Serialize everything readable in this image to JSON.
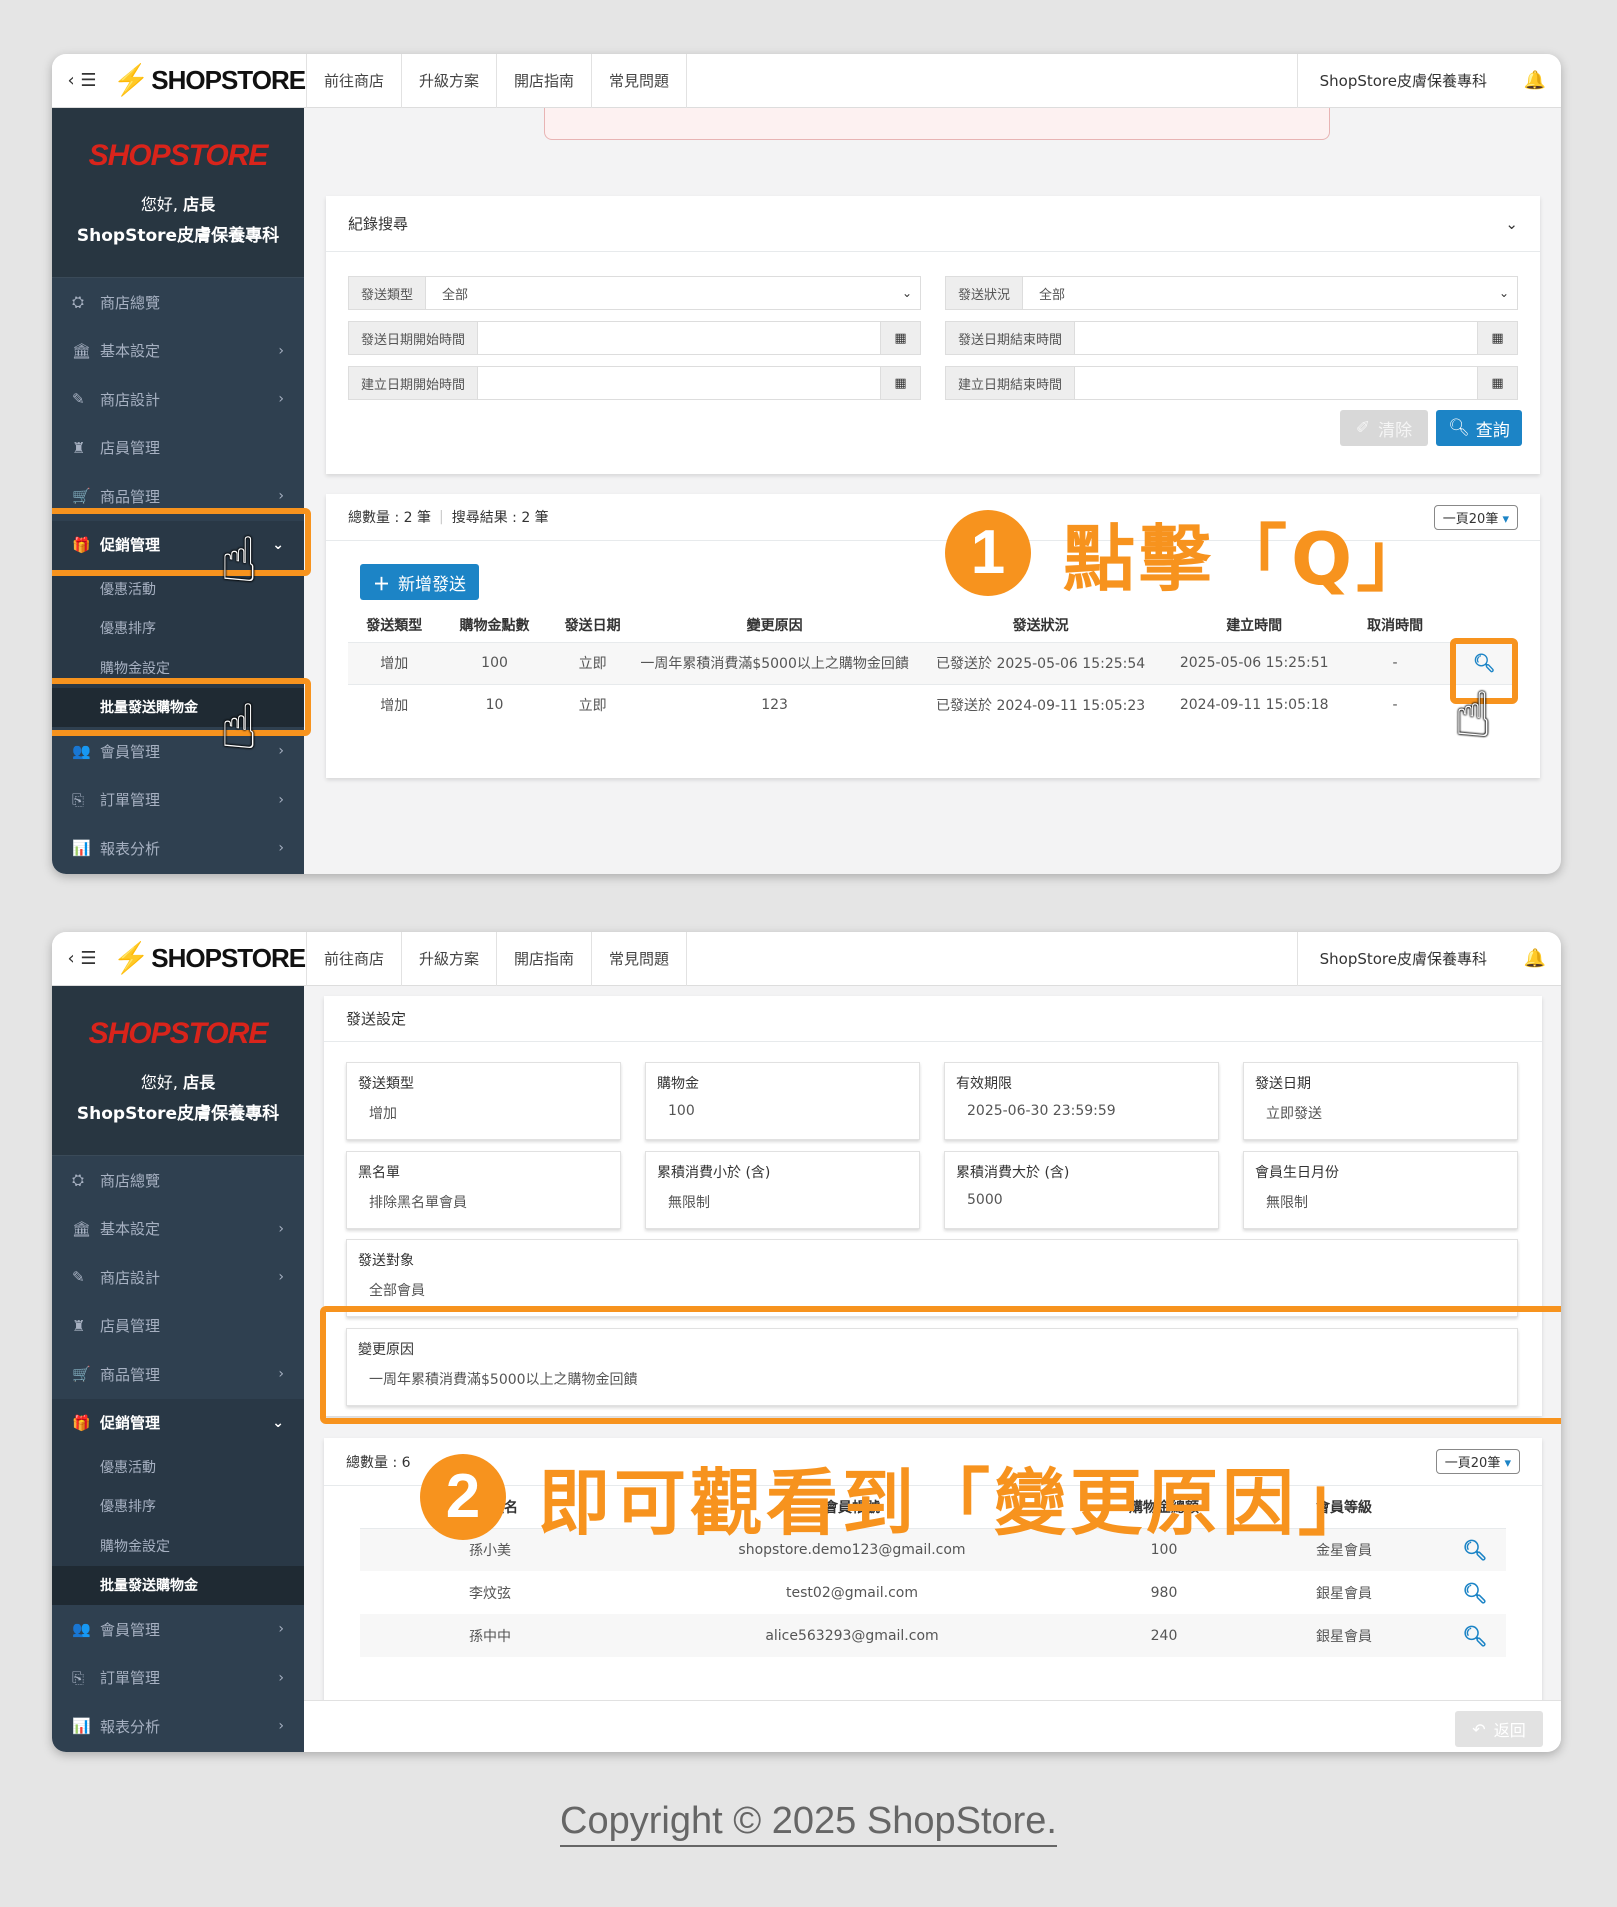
{
  "topbar": {
    "toggle": "‹ ☰",
    "logo": "SHOPSTORE",
    "nav": [
      "前往商店",
      "升級方案",
      "開店指南",
      "常見問題"
    ],
    "store_name": "ShopStore皮膚保養專科",
    "bell": "🔔"
  },
  "sidebar": {
    "logo": "SHOPSTORE",
    "hello": "您好,",
    "role": "店長",
    "store": "ShopStore皮膚保養專科",
    "items": [
      {
        "label": "商店總覽",
        "icon": "⛭"
      },
      {
        "label": "基本設定",
        "icon": "🏛"
      },
      {
        "label": "商店設計",
        "icon": "✎"
      },
      {
        "label": "店員管理",
        "icon": "♜"
      },
      {
        "label": "商品管理",
        "icon": "🛒"
      },
      {
        "label": "促銷管理",
        "icon": "🎁"
      }
    ],
    "sub_items": [
      "優惠活動",
      "優惠排序",
      "購物金設定",
      "批量發送購物金"
    ],
    "items_after": [
      {
        "label": "會員管理",
        "icon": "👥"
      },
      {
        "label": "訂單管理",
        "icon": "⎘"
      },
      {
        "label": "報表分析",
        "icon": "📊"
      }
    ],
    "chevron_right": "›",
    "chevron_down": "⌄"
  },
  "search": {
    "title": "紀錄搜尋",
    "collapse": "⌄",
    "send_type_label": "發送類型",
    "send_type_value": "全部",
    "send_status_label": "發送狀況",
    "send_status_value": "全部",
    "send_date_start": "發送日期開始時間",
    "send_date_end": "發送日期結束時間",
    "create_date_start": "建立日期開始時間",
    "create_date_end": "建立日期結束時間",
    "calendar_icon": "▦",
    "select_caret": "⌄",
    "clear_label": "清除",
    "query_label": "查詢"
  },
  "results": {
    "total": "總數量 : 2 筆",
    "search_result": "搜尋結果 : 2 筆",
    "per_page": "一頁20筆",
    "add_label": "新增發送",
    "headers": [
      "發送類型",
      "購物金點數",
      "發送日期",
      "變更原因",
      "發送狀況",
      "建立時間",
      "取消時間"
    ],
    "rows": [
      [
        "增加",
        "100",
        "立即",
        "一周年累積消費滿$5000以上之購物金回饋",
        "已發送於 2025-05-06 15:25:54",
        "2025-05-06 15:25:51",
        "-"
      ],
      [
        "增加",
        "10",
        "立即",
        "123",
        "已發送於 2024-09-11 15:05:23",
        "2024-09-11 15:05:18",
        "-"
      ]
    ]
  },
  "step1": {
    "number": "1",
    "text": "點擊「Q」"
  },
  "detail": {
    "title": "發送設定",
    "fields": [
      {
        "label": "發送類型",
        "value": "增加"
      },
      {
        "label": "購物金",
        "value": "100"
      },
      {
        "label": "有效期限",
        "value": "2025-06-30 23:59:59"
      },
      {
        "label": "發送日期",
        "value": "立即發送"
      },
      {
        "label": "黑名單",
        "value": "排除黑名單會員"
      },
      {
        "label": "累積消費小於 (含)",
        "value": "無限制"
      },
      {
        "label": "累積消費大於 (含)",
        "value": "5000"
      },
      {
        "label": "會員生日月份",
        "value": "無限制"
      }
    ],
    "target_label": "發送對象",
    "target_value": "全部會員",
    "reason_label": "變更原因",
    "reason_value": "一周年累積消費滿$5000以上之購物金回饋"
  },
  "members": {
    "total": "總數量 : 6",
    "per_page": "一頁20筆",
    "headers": [
      "會員姓名",
      "會員帳號",
      "購物金總額",
      "會員等級"
    ],
    "rows": [
      [
        "孫小美",
        "shopstore.demo123@gmail.com",
        "100",
        "金星會員"
      ],
      [
        "李炆弦",
        "test02@gmail.com",
        "980",
        "銀星會員"
      ],
      [
        "孫中中",
        "alice563293@gmail.com",
        "240",
        "銀星會員"
      ]
    ],
    "back_label": "返回"
  },
  "step2": {
    "number": "2",
    "text": "即可觀看到「變更原因」"
  },
  "copyright": "Copyright © 2025 ShopStore."
}
